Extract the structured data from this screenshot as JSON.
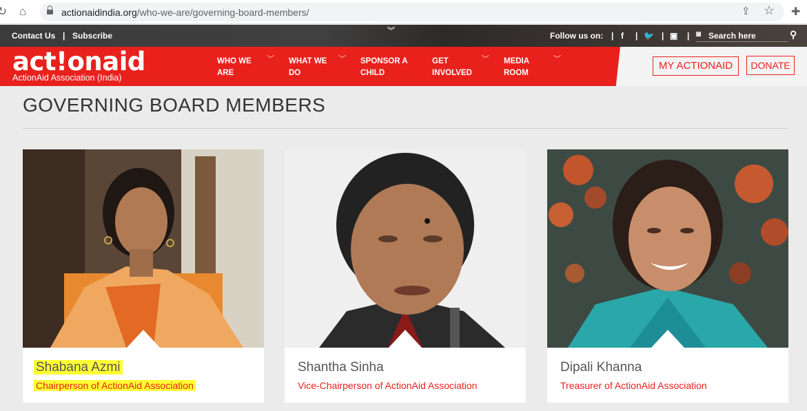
{
  "browser": {
    "url_host": "actionaidindia.org",
    "url_path": "/who-we-are/governing-board-members/"
  },
  "topbar": {
    "contact": "Contact Us",
    "subscribe": "Subscribe",
    "follow": "Follow us on:",
    "search_placeholder": "Search here"
  },
  "header": {
    "logo_word": "act!onaid",
    "logo_sub": "ActionAid Association (India)",
    "menu": [
      {
        "line1": "WHO WE",
        "line2": "ARE"
      },
      {
        "line1": "WHAT WE",
        "line2": "DO"
      },
      {
        "line1": "SPONSOR A",
        "line2": "CHILD"
      },
      {
        "line1": "GET",
        "line2": "INVOLVED"
      },
      {
        "line1": "MEDIA",
        "line2": "ROOM"
      }
    ],
    "my_actionaid": "MY ACTIONAID",
    "donate": "DONATE"
  },
  "page": {
    "title": "GOVERNING BOARD MEMBERS",
    "members": [
      {
        "name": "Shabana Azmi",
        "role": "Chairperson of ActionAid Association"
      },
      {
        "name": "Shantha Sinha",
        "role": "Vice-Chairperson of ActionAid Association"
      },
      {
        "name": "Dipali Khanna",
        "role": "Treasurer of ActionAid Association"
      }
    ]
  },
  "colors": {
    "brand_red": "#e8211d",
    "highlight": "#ffff33"
  }
}
